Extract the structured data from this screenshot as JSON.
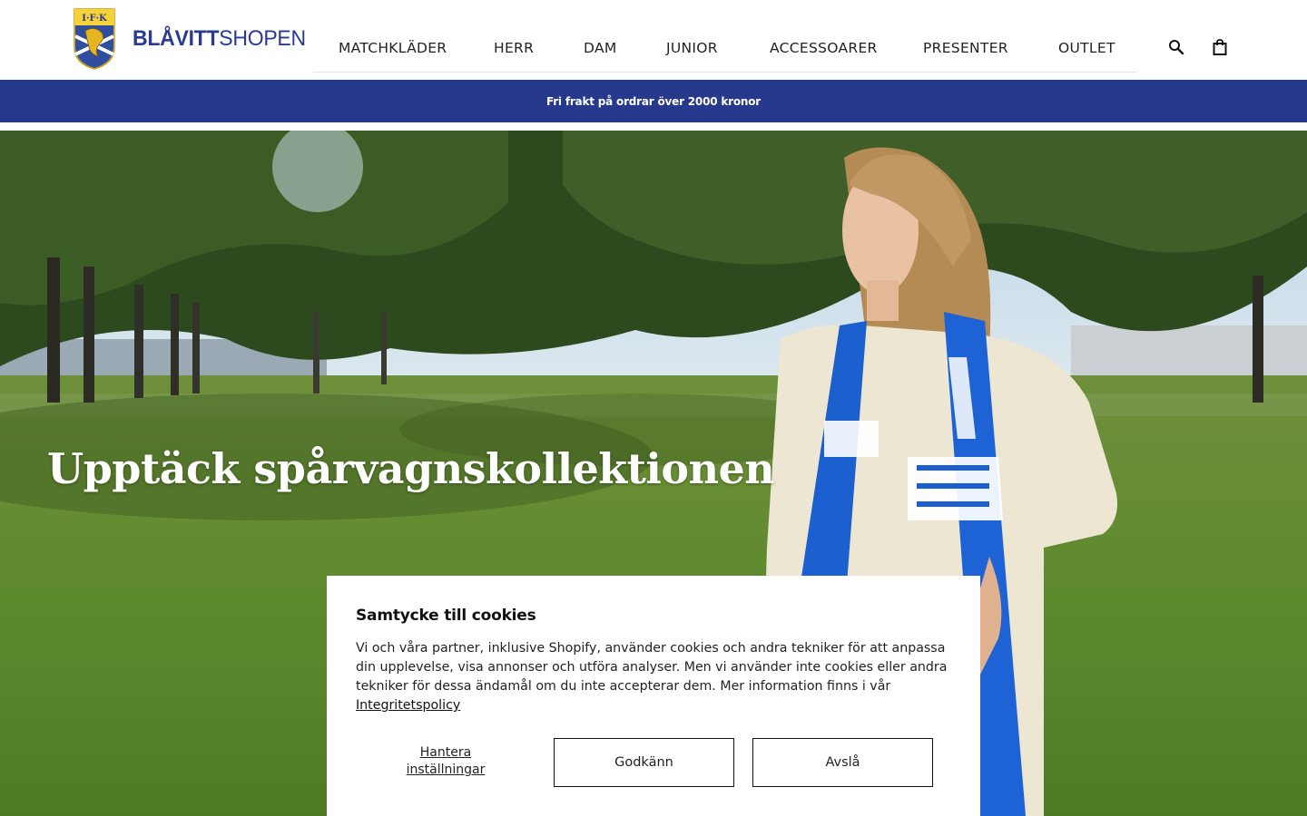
{
  "header": {
    "brand_bold": "BLÅVITT",
    "brand_light": "SHOPEN",
    "crest_text": "I·F·K",
    "nav": [
      {
        "label": "MATCHKLÄDER"
      },
      {
        "label": "HERR"
      },
      {
        "label": "DAM"
      },
      {
        "label": "JUNIOR"
      },
      {
        "label": "ACCESSOARER"
      },
      {
        "label": "PRESENTER"
      },
      {
        "label": "OUTLET"
      }
    ],
    "icons": {
      "search": "search-icon",
      "cart": "shopping-bag-icon"
    }
  },
  "announcement": {
    "text": "Fri frakt på ordrar över 2000 kronor",
    "bg_color": "#26398c"
  },
  "hero": {
    "title": "Upptäck spårvagnskollektionen"
  },
  "cookie_banner": {
    "title": "Samtycke till cookies",
    "body": "Vi och våra partner, inklusive Shopify, använder cookies och andra tekniker för att anpassa din upplevelse, visa annonser och utföra analyser. Men vi använder inte cookies eller andra tekniker för dessa ändamål om du inte accepterar dem. Mer information finns i vår ",
    "policy_link": "Integritetspolicy",
    "manage_label": "Hantera inställningar",
    "accept_label": "Godkänn",
    "decline_label": "Avslå"
  },
  "colors": {
    "brand_blue": "#2a3b8f",
    "crest_gold": "#e6b520"
  }
}
